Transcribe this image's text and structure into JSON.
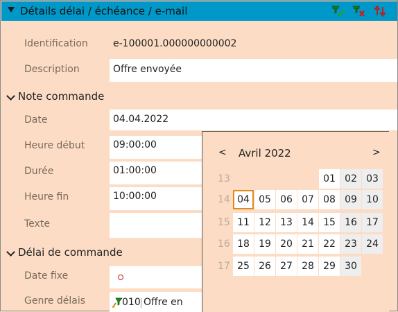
{
  "header": {
    "title": "Détails délai / échéance / e-mail"
  },
  "fields": {
    "identification": {
      "label": "Identification",
      "value": "e-100001.000000000002"
    },
    "description": {
      "label": "Description",
      "value": "Offre envoyée"
    }
  },
  "section_note": {
    "title": "Note commande",
    "date": {
      "label": "Date",
      "value": "04.04.2022"
    },
    "start_time": {
      "label": "Heure début",
      "value": "09:00:00"
    },
    "duration": {
      "label": "Durée",
      "value": "01:00:00"
    },
    "end_time": {
      "label": "Heure fin",
      "value": "10:00:00"
    },
    "text": {
      "label": "Texte",
      "value": ""
    }
  },
  "section_delay": {
    "title": "Délai de commande",
    "fixed_date": {
      "label": "Date fixe"
    },
    "delay_type": {
      "label": "Genre délais",
      "code": "010",
      "value": "Offre en"
    }
  },
  "calendar": {
    "prev": "<",
    "next": ">",
    "month": "Avril 2022",
    "weeks": [
      {
        "wk": "13",
        "days": [
          "",
          "",
          "",
          "",
          "01",
          "02",
          "03"
        ]
      },
      {
        "wk": "14",
        "days": [
          "04",
          "05",
          "06",
          "07",
          "08",
          "09",
          "10"
        ]
      },
      {
        "wk": "15",
        "days": [
          "11",
          "12",
          "13",
          "14",
          "15",
          "16",
          "17"
        ]
      },
      {
        "wk": "16",
        "days": [
          "18",
          "19",
          "20",
          "21",
          "22",
          "23",
          "24"
        ]
      },
      {
        "wk": "17",
        "days": [
          "25",
          "26",
          "27",
          "28",
          "29",
          "30",
          ""
        ]
      }
    ],
    "selected": "04"
  },
  "colors": {
    "header": "#0098c8",
    "background": "#fcdcc4",
    "today_border": "#e08a1c"
  },
  "icons": {
    "header_1": "filter-check-icon",
    "header_2": "filter-remove-icon",
    "header_3": "swap-arrows-icon",
    "delay_type": "filter-flag-icon"
  }
}
